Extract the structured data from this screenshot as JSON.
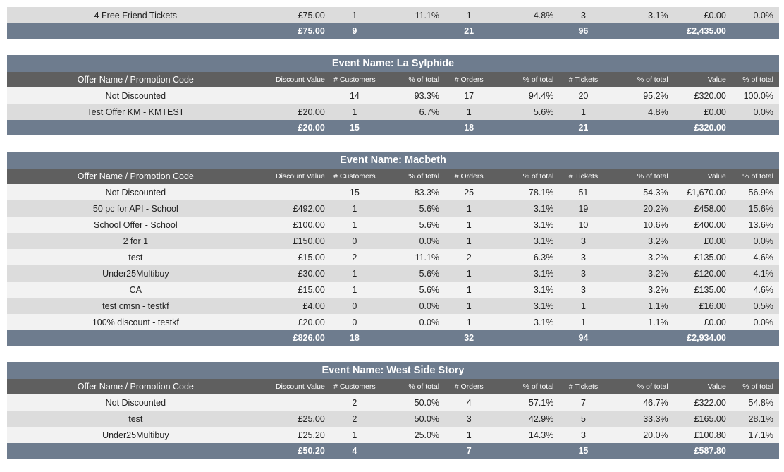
{
  "top_fragment": {
    "rows": [
      [
        "4 Free Friend Tickets",
        "£75.00",
        "1",
        "11.1%",
        "1",
        "4.8%",
        "3",
        "3.1%",
        "£0.00",
        "0.0%"
      ]
    ],
    "total": [
      "",
      "£75.00",
      "9",
      "",
      "21",
      "",
      "96",
      "",
      "£2,435.00",
      ""
    ]
  },
  "columns": [
    "Offer Name / Promotion Code",
    "Discount Value",
    "# Customers",
    "% of total",
    "# Orders",
    "% of total",
    "# Tickets",
    "% of total",
    "Value",
    "% of total"
  ],
  "events": [
    {
      "title": "Event Name: La Sylphide",
      "rows": [
        [
          "Not Discounted",
          "",
          "14",
          "93.3%",
          "17",
          "94.4%",
          "20",
          "95.2%",
          "£320.00",
          "100.0%"
        ],
        [
          "Test Offer KM - KMTEST",
          "£20.00",
          "1",
          "6.7%",
          "1",
          "5.6%",
          "1",
          "4.8%",
          "£0.00",
          "0.0%"
        ]
      ],
      "total": [
        "",
        "£20.00",
        "15",
        "",
        "18",
        "",
        "21",
        "",
        "£320.00",
        ""
      ]
    },
    {
      "title": "Event Name: Macbeth",
      "rows": [
        [
          "Not Discounted",
          "",
          "15",
          "83.3%",
          "25",
          "78.1%",
          "51",
          "54.3%",
          "£1,670.00",
          "56.9%"
        ],
        [
          "50 pc for API - School",
          "£492.00",
          "1",
          "5.6%",
          "1",
          "3.1%",
          "19",
          "20.2%",
          "£458.00",
          "15.6%"
        ],
        [
          "School Offer - School",
          "£100.00",
          "1",
          "5.6%",
          "1",
          "3.1%",
          "10",
          "10.6%",
          "£400.00",
          "13.6%"
        ],
        [
          "2 for 1",
          "£150.00",
          "0",
          "0.0%",
          "1",
          "3.1%",
          "3",
          "3.2%",
          "£0.00",
          "0.0%"
        ],
        [
          "test",
          "£15.00",
          "2",
          "11.1%",
          "2",
          "6.3%",
          "3",
          "3.2%",
          "£135.00",
          "4.6%"
        ],
        [
          "Under25Multibuy",
          "£30.00",
          "1",
          "5.6%",
          "1",
          "3.1%",
          "3",
          "3.2%",
          "£120.00",
          "4.1%"
        ],
        [
          "CA",
          "£15.00",
          "1",
          "5.6%",
          "1",
          "3.1%",
          "3",
          "3.2%",
          "£135.00",
          "4.6%"
        ],
        [
          "test cmsn - testkf",
          "£4.00",
          "0",
          "0.0%",
          "1",
          "3.1%",
          "1",
          "1.1%",
          "£16.00",
          "0.5%"
        ],
        [
          "100% discount - testkf",
          "£20.00",
          "0",
          "0.0%",
          "1",
          "3.1%",
          "1",
          "1.1%",
          "£0.00",
          "0.0%"
        ]
      ],
      "total": [
        "",
        "£826.00",
        "18",
        "",
        "32",
        "",
        "94",
        "",
        "£2,934.00",
        ""
      ]
    },
    {
      "title": "Event Name: West Side Story",
      "rows": [
        [
          "Not Discounted",
          "",
          "2",
          "50.0%",
          "4",
          "57.1%",
          "7",
          "46.7%",
          "£322.00",
          "54.8%"
        ],
        [
          "test",
          "£25.00",
          "2",
          "50.0%",
          "3",
          "42.9%",
          "5",
          "33.3%",
          "£165.00",
          "28.1%"
        ],
        [
          "Under25Multibuy",
          "£25.20",
          "1",
          "25.0%",
          "1",
          "14.3%",
          "3",
          "20.0%",
          "£100.80",
          "17.1%"
        ]
      ],
      "total": [
        "",
        "£50.20",
        "4",
        "",
        "7",
        "",
        "15",
        "",
        "£587.80",
        ""
      ]
    }
  ]
}
